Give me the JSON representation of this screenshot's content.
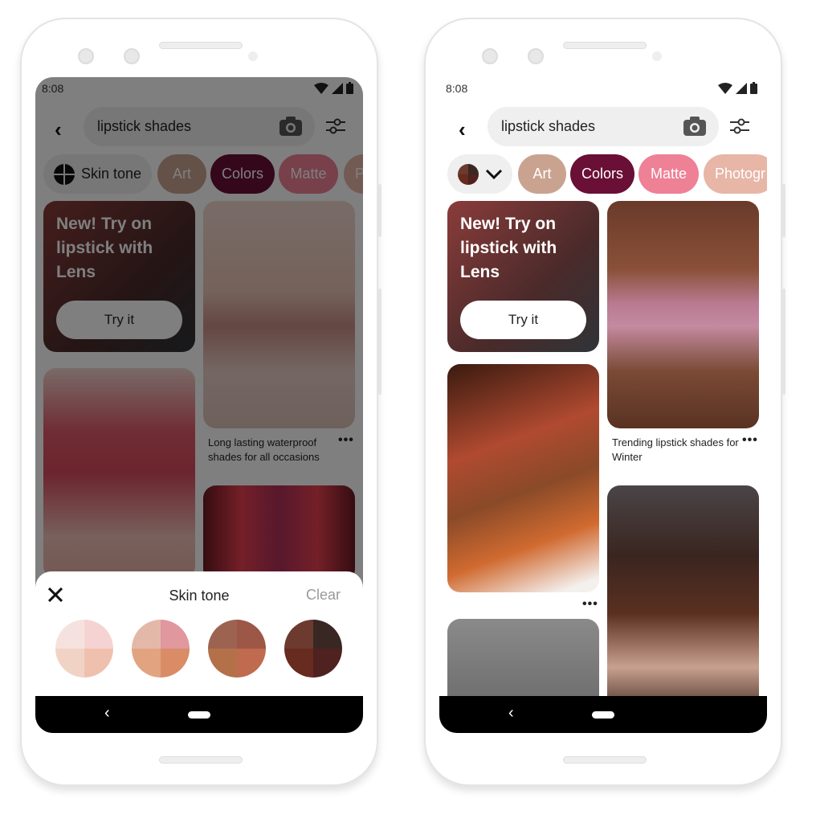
{
  "status_time": "8:08",
  "search": {
    "query": "lipstick shades"
  },
  "chips": {
    "skin_tone": "Skin tone",
    "art": "Art",
    "colors": "Colors",
    "matte": "Matte",
    "photography": "Photogr",
    "partial": "P"
  },
  "colors": {
    "art": "#c9a390",
    "colors": "#6a0f35",
    "matte": "#ee8196",
    "photography": "#e7b6a6"
  },
  "promo": {
    "title": "New! Try on lipstick with Lens",
    "button": "Try it"
  },
  "left_phone": {
    "caption": "Long lasting waterproof shades for all occasions"
  },
  "right_phone": {
    "caption": "Trending lipstick shades for Winter"
  },
  "more_label": "•••",
  "sheet": {
    "title": "Skin tone",
    "clear": "Clear",
    "swatches": [
      [
        "#f5e2df",
        "#f6d3d3",
        "#f1d3c6",
        "#f0c0ae"
      ],
      [
        "#e4b8a8",
        "#e0979e",
        "#e2a381",
        "#d98c66"
      ],
      [
        "#9d6351",
        "#9d5746",
        "#b47049",
        "#c06a50"
      ],
      [
        "#6c3a2f",
        "#392724",
        "#672b1f",
        "#4f211f"
      ]
    ]
  },
  "nav": {
    "back": "‹"
  }
}
